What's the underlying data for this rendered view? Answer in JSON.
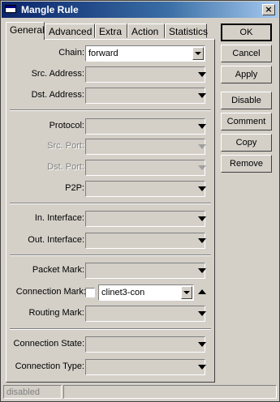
{
  "window": {
    "title": "Mangle Rule",
    "close_glyph": "×"
  },
  "tabs": [
    {
      "label": "General",
      "active": true
    },
    {
      "label": "Advanced"
    },
    {
      "label": "Extra"
    },
    {
      "label": "Action"
    },
    {
      "label": "Statistics"
    }
  ],
  "fields": {
    "chain": {
      "label": "Chain:",
      "value": "forward"
    },
    "src_address": {
      "label": "Src. Address:"
    },
    "dst_address": {
      "label": "Dst. Address:"
    },
    "protocol": {
      "label": "Protocol:"
    },
    "src_port": {
      "label": "Src. Port:"
    },
    "dst_port": {
      "label": "Dst. Port:"
    },
    "p2p": {
      "label": "P2P:"
    },
    "in_interface": {
      "label": "In. Interface:"
    },
    "out_interface": {
      "label": "Out. Interface:"
    },
    "packet_mark": {
      "label": "Packet Mark:"
    },
    "connection_mark": {
      "label": "Connection Mark:",
      "value": "clinet3-con",
      "negate_checked": false
    },
    "routing_mark": {
      "label": "Routing Mark:"
    },
    "connection_state": {
      "label": "Connection State:"
    },
    "connection_type": {
      "label": "Connection Type:"
    }
  },
  "buttons": {
    "ok": "OK",
    "cancel": "Cancel",
    "apply": "Apply",
    "disable": "Disable",
    "comment": "Comment",
    "copy": "Copy",
    "remove": "Remove"
  },
  "status": {
    "text": "disabled"
  },
  "icons": {
    "dropdown": "chevron-down-icon",
    "collapse": "chevron-up-icon",
    "window": "window-icon"
  }
}
